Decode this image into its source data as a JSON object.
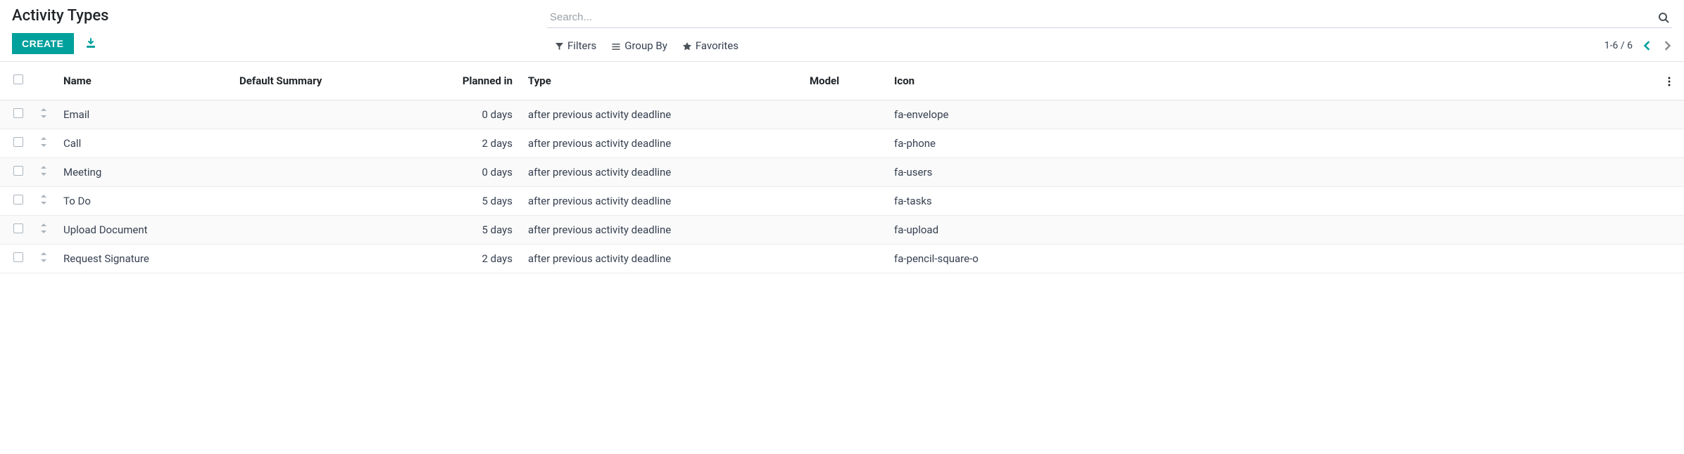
{
  "page": {
    "title": "Activity Types",
    "create_label": "CREATE"
  },
  "search": {
    "placeholder": "Search..."
  },
  "filters": {
    "filters_label": "Filters",
    "group_by_label": "Group By",
    "favorites_label": "Favorites"
  },
  "pager": {
    "range": "1-6 / 6"
  },
  "columns": {
    "name": "Name",
    "default_summary": "Default Summary",
    "planned_in": "Planned in",
    "type": "Type",
    "model": "Model",
    "icon": "Icon"
  },
  "rows": [
    {
      "name": "Email",
      "default_summary": "",
      "planned_in": "0 days",
      "type": "after previous activity deadline",
      "model": "",
      "icon": "fa-envelope"
    },
    {
      "name": "Call",
      "default_summary": "",
      "planned_in": "2 days",
      "type": "after previous activity deadline",
      "model": "",
      "icon": "fa-phone"
    },
    {
      "name": "Meeting",
      "default_summary": "",
      "planned_in": "0 days",
      "type": "after previous activity deadline",
      "model": "",
      "icon": "fa-users"
    },
    {
      "name": "To Do",
      "default_summary": "",
      "planned_in": "5 days",
      "type": "after previous activity deadline",
      "model": "",
      "icon": "fa-tasks"
    },
    {
      "name": "Upload Document",
      "default_summary": "",
      "planned_in": "5 days",
      "type": "after previous activity deadline",
      "model": "",
      "icon": "fa-upload"
    },
    {
      "name": "Request Signature",
      "default_summary": "",
      "planned_in": "2 days",
      "type": "after previous activity deadline",
      "model": "",
      "icon": "fa-pencil-square-o"
    }
  ]
}
